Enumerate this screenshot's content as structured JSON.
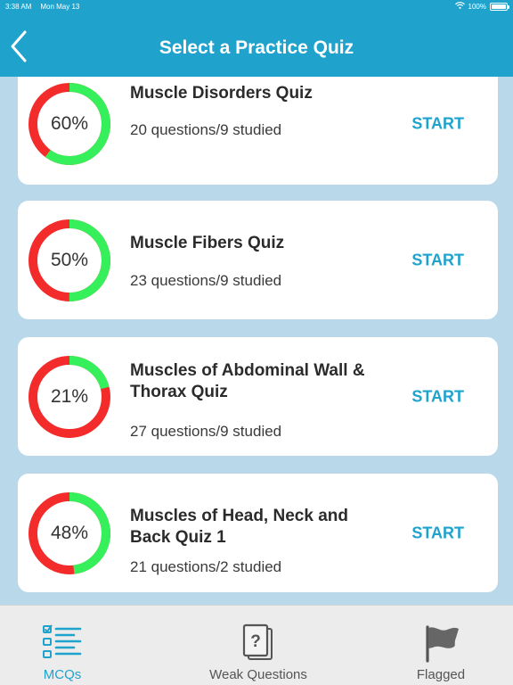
{
  "status_bar": {
    "time": "3:38 AM",
    "date": "Mon May 13",
    "battery": "100%"
  },
  "nav": {
    "title": "Select a Practice Quiz"
  },
  "quizzes": [
    {
      "percent": "60%",
      "progress": 0.6,
      "title": "Muscle Disorders Quiz",
      "subtitle": "20 questions/9 studied",
      "action": "START"
    },
    {
      "percent": "50%",
      "progress": 0.5,
      "title": "Muscle Fibers Quiz",
      "subtitle": "23 questions/9 studied",
      "action": "START"
    },
    {
      "percent": "21%",
      "progress": 0.21,
      "title": "Muscles of Abdominal Wall & Thorax Quiz",
      "subtitle": "27 questions/9 studied",
      "action": "START"
    },
    {
      "percent": "48%",
      "progress": 0.48,
      "title": "Muscles of Head, Neck and Back Quiz 1",
      "subtitle": "21 questions/2 studied",
      "action": "START"
    }
  ],
  "tabs": [
    {
      "label": "MCQs",
      "icon": "checklist-icon",
      "active": true
    },
    {
      "label": "Weak Questions",
      "icon": "question-cards-icon",
      "active": false
    },
    {
      "label": "Flagged",
      "icon": "flag-icon",
      "active": false
    }
  ],
  "colors": {
    "primary": "#1fa3cd",
    "ring_done": "#35f05a",
    "ring_remaining": "#f42b2b",
    "tab_inactive": "#555555"
  }
}
